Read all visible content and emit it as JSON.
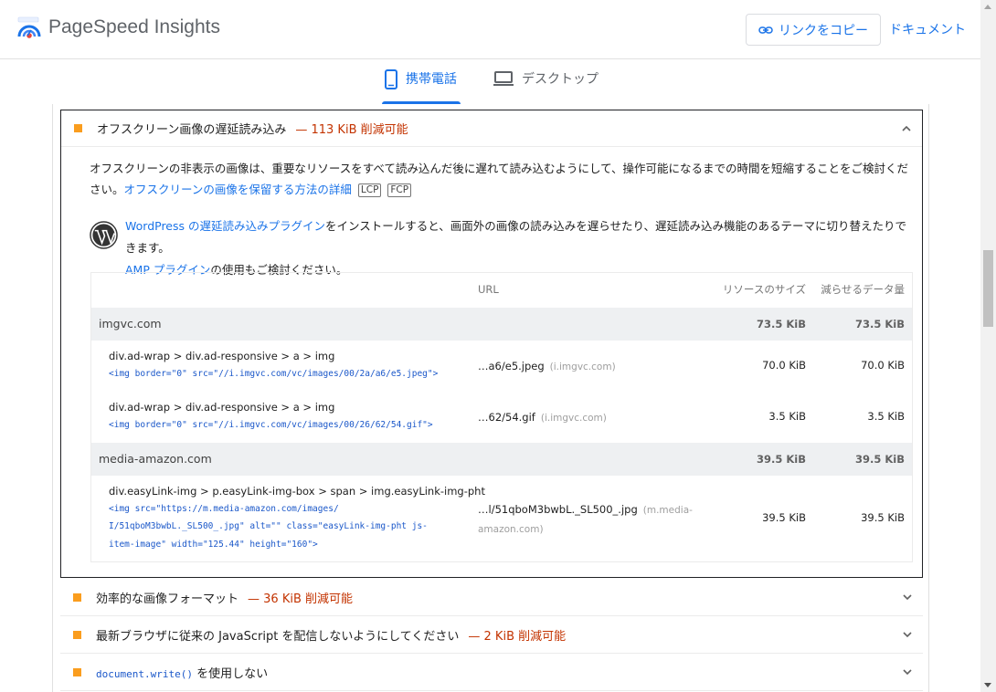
{
  "header": {
    "app_title": "PageSpeed Insights",
    "copy_link_label": "リンクをコピー",
    "docs_label": "ドキュメント"
  },
  "tabs": [
    {
      "label": "携帯電話",
      "active": true
    },
    {
      "label": "デスクトップ",
      "active": false
    }
  ],
  "open_audit": {
    "title": "オフスクリーン画像の遅延読み込み",
    "savings": "— 113 KiB 削減可能",
    "description": "オフスクリーンの非表示の画像は、重要なリソースをすべて読み込んだ後に遅れて読み込むようにして、操作可能になるまでの時間を短縮することをご検討ください。",
    "learn_more_label": "オフスクリーンの画像を保留する方法の詳細",
    "metric_tags": [
      "LCP",
      "FCP"
    ],
    "wordpress_note": {
      "link1": "WordPress の遅延読み込みプラグイン",
      "text1": "をインストールすると、画面外の画像の読み込みを遅らせたり、遅延読み込み機能のあるテーマに切り替えたりできます。",
      "link2": "AMP プラグイン",
      "text2": "の使用もご検討ください。"
    },
    "table": {
      "headers": {
        "url": "URL",
        "resource_size": "リソースのサイズ",
        "savings": "減らせるデータ量"
      },
      "groups": [
        {
          "name": "imgvc.com",
          "resource_size": "73.5 KiB",
          "savings": "73.5 KiB",
          "items": [
            {
              "selector": "div.ad-wrap > div.ad-responsive > a > img",
              "snippet": [
                "<img border=\"0\" src=\"//i.imgvc.com/vc/images/00/2a/a6/e5.jpeg\">"
              ],
              "url": "…a6/e5.jpeg",
              "host": "(i.imgvc.com)",
              "resource_size": "70.0 KiB",
              "savings": "70.0 KiB"
            },
            {
              "selector": "div.ad-wrap > div.ad-responsive > a > img",
              "snippet": [
                "<img border=\"0\" src=\"//i.imgvc.com/vc/images/00/26/62/54.gif\">"
              ],
              "url": "…62/54.gif",
              "host": "(i.imgvc.com)",
              "resource_size": "3.5 KiB",
              "savings": "3.5 KiB"
            }
          ]
        },
        {
          "name": "media-amazon.com",
          "resource_size": "39.5 KiB",
          "savings": "39.5 KiB",
          "items": [
            {
              "selector": "div.easyLink-img > p.easyLink-img-box > span > img.easyLink-img-pht",
              "snippet": [
                "<img src=\"https://m.media-amazon.com/images/",
                "I/51qboM3bwbL._SL500_.jpg\" alt=\"\" class=\"easyLink-img-pht js-",
                "item-image\" width=\"125.44\" height=\"160\">"
              ],
              "url": "…l/51qboM3bwbL._SL500_.jpg",
              "host_line1": "(m.media-",
              "host_line2": "amazon.com)",
              "resource_size": "39.5 KiB",
              "savings": "39.5 KiB"
            }
          ]
        }
      ]
    }
  },
  "other_audits": [
    {
      "title": "効率的な画像フォーマット",
      "savings": "— 36 KiB 削減可能"
    },
    {
      "title": "最新ブラウザに従来の JavaScript を配信しないようにしてください",
      "savings": "— 2 KiB 削減可能"
    },
    {
      "title_code": "document.write()",
      "title_suffix": " を使用しない"
    }
  ],
  "colors": {
    "accent": "#1a73e8",
    "warning_square": "#fa9d1e",
    "savings_text": "#c33300",
    "code_text": "#1a57c9"
  }
}
